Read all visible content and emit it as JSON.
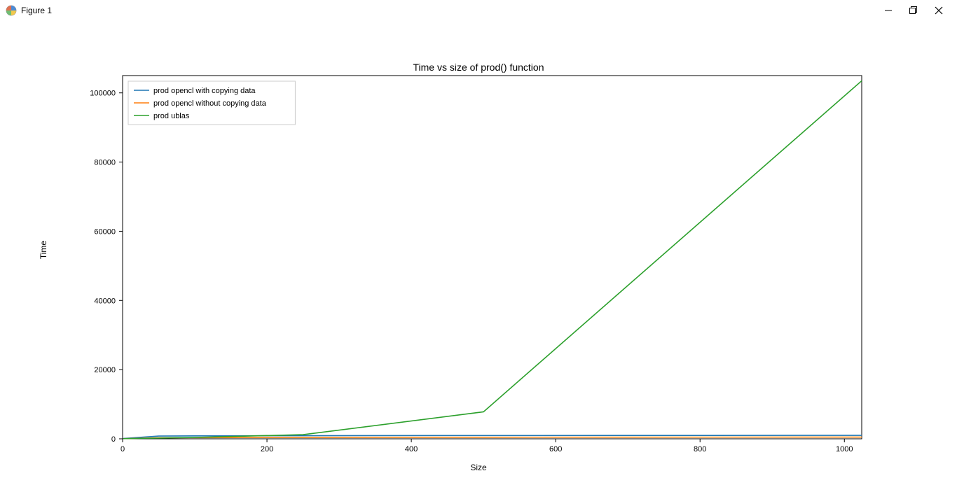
{
  "window": {
    "title": "Figure 1"
  },
  "chart_data": {
    "type": "line",
    "title": "Time vs size of prod() function",
    "xlabel": "Size",
    "ylabel": "Time",
    "xlim": [
      0,
      1024
    ],
    "ylim": [
      0,
      105000
    ],
    "xticks": [
      0,
      200,
      400,
      600,
      800,
      1000
    ],
    "yticks": [
      0,
      20000,
      40000,
      60000,
      80000,
      100000
    ],
    "x": [
      1,
      50,
      100,
      250,
      500,
      1024
    ],
    "series": [
      {
        "name": "prod opencl with copying data",
        "color": "#1f77b4",
        "values": [
          100,
          800,
          850,
          900,
          950,
          1000
        ]
      },
      {
        "name": "prod opencl without copying data",
        "color": "#ff7f0e",
        "values": [
          50,
          300,
          350,
          400,
          450,
          500
        ]
      },
      {
        "name": "prod ublas",
        "color": "#2ca02c",
        "values": [
          50,
          200,
          400,
          1200,
          7800,
          103500
        ]
      }
    ],
    "legend_position": "upper left"
  }
}
